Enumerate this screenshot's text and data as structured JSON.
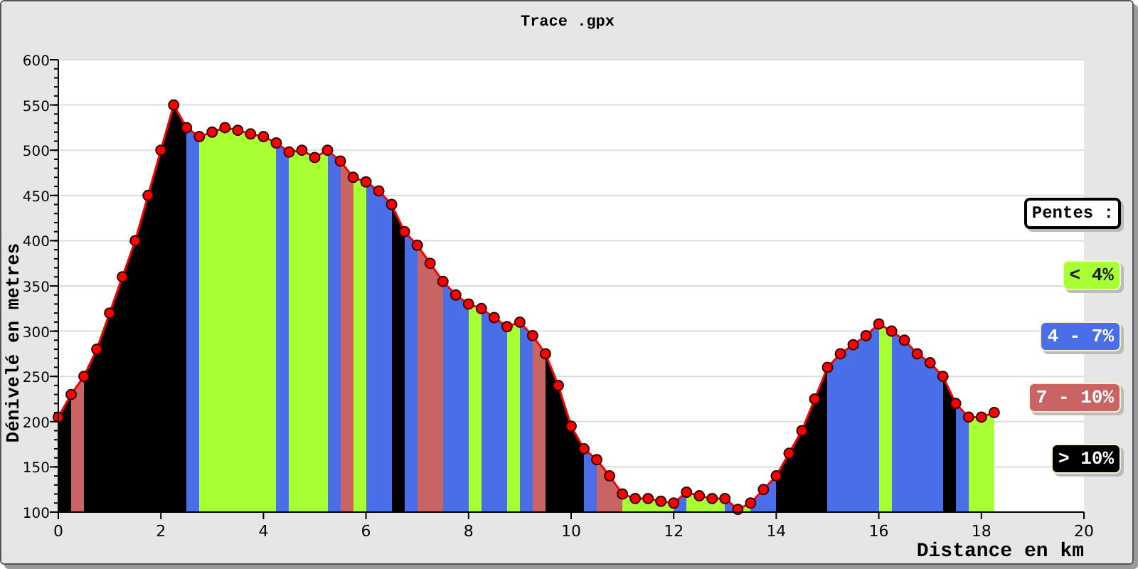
{
  "chart": {
    "chart_data": {
      "type": "area",
      "grid": true,
      "title": "Trace .gpx",
      "xlabel": "Distance en km",
      "ylabel": "Dénivelé en metres",
      "x": [
        0,
        0.25,
        0.5,
        0.75,
        1,
        1.25,
        1.5,
        1.75,
        2,
        2.25,
        2.5,
        2.75,
        3,
        3.25,
        3.5,
        3.75,
        4,
        4.25,
        4.5,
        4.75,
        5,
        5.25,
        5.5,
        5.75,
        6,
        6.25,
        6.5,
        6.75,
        7,
        7.25,
        7.5,
        7.75,
        8,
        8.25,
        8.5,
        8.75,
        9,
        9.25,
        9.5,
        9.75,
        10,
        10.25,
        10.5,
        10.75,
        11,
        11.25,
        11.5,
        11.75,
        12,
        12.25,
        12.5,
        12.75,
        13,
        13.25,
        13.5,
        13.75,
        14,
        14.25,
        14.5,
        14.75,
        15,
        15.25,
        15.5,
        15.75,
        16,
        16.25,
        16.5,
        16.75,
        17,
        17.25,
        17.5,
        17.75,
        18,
        18.25
      ],
      "series": [
        {
          "color": "#ff0000",
          "marker": "circle",
          "values": [
            205,
            230,
            250,
            280,
            320,
            360,
            400,
            450,
            500,
            550,
            525,
            515,
            520,
            525,
            522,
            518,
            515,
            508,
            498,
            500,
            492,
            500,
            488,
            470,
            465,
            455,
            440,
            410,
            395,
            375,
            355,
            340,
            330,
            325,
            315,
            305,
            310,
            295,
            275,
            240,
            195,
            170,
            158,
            140,
            120,
            115,
            115,
            112,
            110,
            122,
            118,
            115,
            115,
            103,
            110,
            125,
            140,
            165,
            190,
            225,
            260,
            275,
            285,
            295,
            308,
            300,
            290,
            275,
            265,
            250,
            220,
            205,
            205,
            210
          ]
        }
      ],
      "xlim": [
        0,
        20
      ],
      "ylim": [
        100,
        600
      ],
      "xticks": [
        0,
        2,
        4,
        6,
        8,
        10,
        12,
        14,
        16,
        18,
        20
      ],
      "yticks": [
        100,
        150,
        200,
        250,
        300,
        350,
        400,
        450,
        500,
        550,
        600
      ]
    }
  },
  "legend": {
    "title": "Pentes :",
    "items": [
      {
        "label": "< 4%",
        "color": "#a8ff33"
      },
      {
        "label": "4 - 7%",
        "color": "#4a6ee8"
      },
      {
        "label": "7 - 10%",
        "color": "#c96464"
      },
      {
        "label": "> 10%",
        "color": "#000000"
      }
    ]
  }
}
